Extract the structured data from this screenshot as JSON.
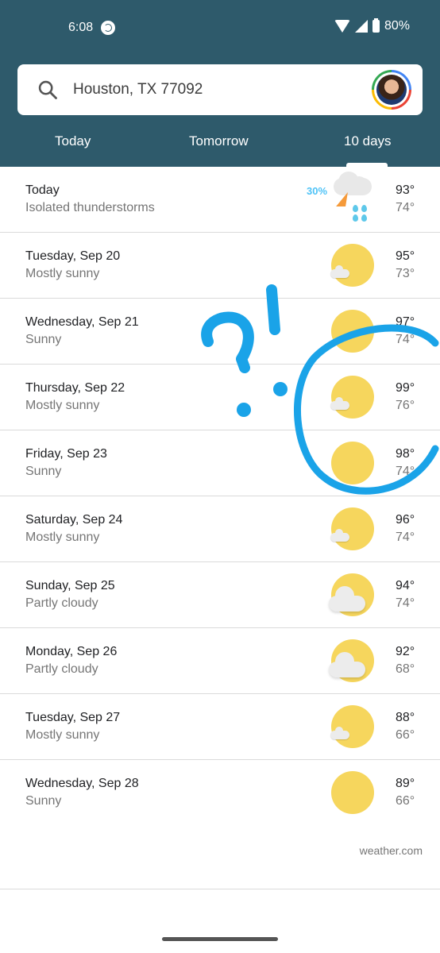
{
  "status_bar": {
    "time": "6:08",
    "battery": "80%"
  },
  "search": {
    "location": "Houston, TX 77092"
  },
  "tabs": [
    {
      "label": "Today"
    },
    {
      "label": "Tomorrow"
    },
    {
      "label": "10 days",
      "selected": true
    }
  ],
  "forecast": [
    {
      "day": "Today",
      "condition": "Isolated thunderstorms",
      "precip": "30%",
      "hi": "93°",
      "lo": "74°",
      "icon": "thunderstorm-icon"
    },
    {
      "day": "Tuesday, Sep 20",
      "condition": "Mostly sunny",
      "hi": "95°",
      "lo": "73°",
      "icon": "mostly-sunny-icon"
    },
    {
      "day": "Wednesday, Sep 21",
      "condition": "Sunny",
      "hi": "97°",
      "lo": "74°",
      "icon": "sunny-icon"
    },
    {
      "day": "Thursday, Sep 22",
      "condition": "Mostly sunny",
      "hi": "99°",
      "lo": "76°",
      "icon": "mostly-sunny-icon"
    },
    {
      "day": "Friday, Sep 23",
      "condition": "Sunny",
      "hi": "98°",
      "lo": "74°",
      "icon": "sunny-icon"
    },
    {
      "day": "Saturday, Sep 24",
      "condition": "Mostly sunny",
      "hi": "96°",
      "lo": "74°",
      "icon": "mostly-sunny-icon"
    },
    {
      "day": "Sunday, Sep 25",
      "condition": "Partly cloudy",
      "hi": "94°",
      "lo": "74°",
      "icon": "partly-cloudy-icon"
    },
    {
      "day": "Monday, Sep 26",
      "condition": "Partly cloudy",
      "hi": "92°",
      "lo": "68°",
      "icon": "partly-cloudy-icon"
    },
    {
      "day": "Tuesday, Sep 27",
      "condition": "Mostly sunny",
      "hi": "88°",
      "lo": "66°",
      "icon": "mostly-sunny-icon"
    },
    {
      "day": "Wednesday, Sep 28",
      "condition": "Sunny",
      "hi": "89°",
      "lo": "66°",
      "icon": "sunny-icon"
    }
  ],
  "footer": {
    "source": "weather.com"
  },
  "colors": {
    "header": "#2e5a6b",
    "sun": "#f6d65d",
    "precip": "#4fc3f7",
    "annotation": "#1aa3e8"
  }
}
